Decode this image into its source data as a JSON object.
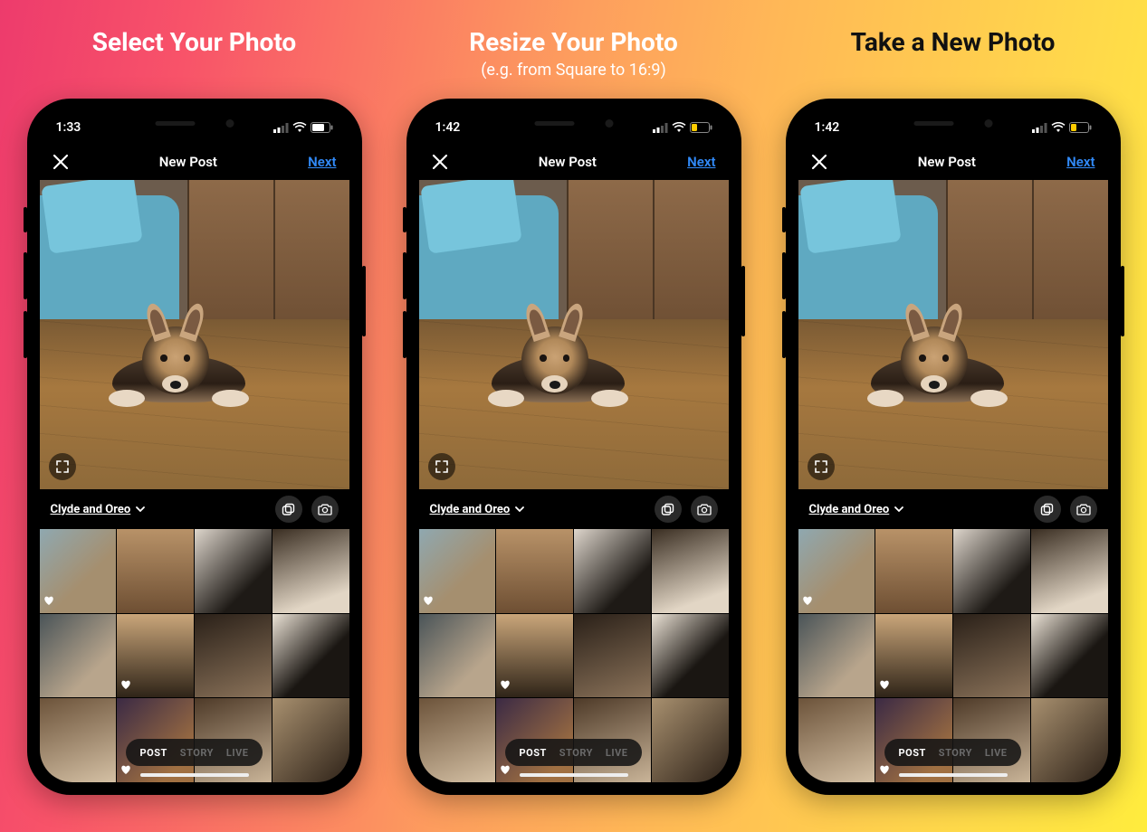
{
  "columns": [
    {
      "title": "Select Your Photo",
      "subtitle": "",
      "titleDark": false,
      "time": "1:33",
      "batteryLow": false
    },
    {
      "title": "Resize Your Photo",
      "subtitle": "(e.g. from Square to 16:9)",
      "titleDark": false,
      "time": "1:42",
      "batteryLow": true
    },
    {
      "title": "Take a New Photo",
      "subtitle": "",
      "titleDark": true,
      "time": "1:42",
      "batteryLow": true
    }
  ],
  "nav": {
    "title": "New Post",
    "next": "Next"
  },
  "album": {
    "name": "Clyde and Oreo"
  },
  "modes": {
    "items": [
      "POST",
      "STORY",
      "LIVE"
    ],
    "active": "POST"
  },
  "thumbHearts": [
    0,
    5,
    9
  ]
}
